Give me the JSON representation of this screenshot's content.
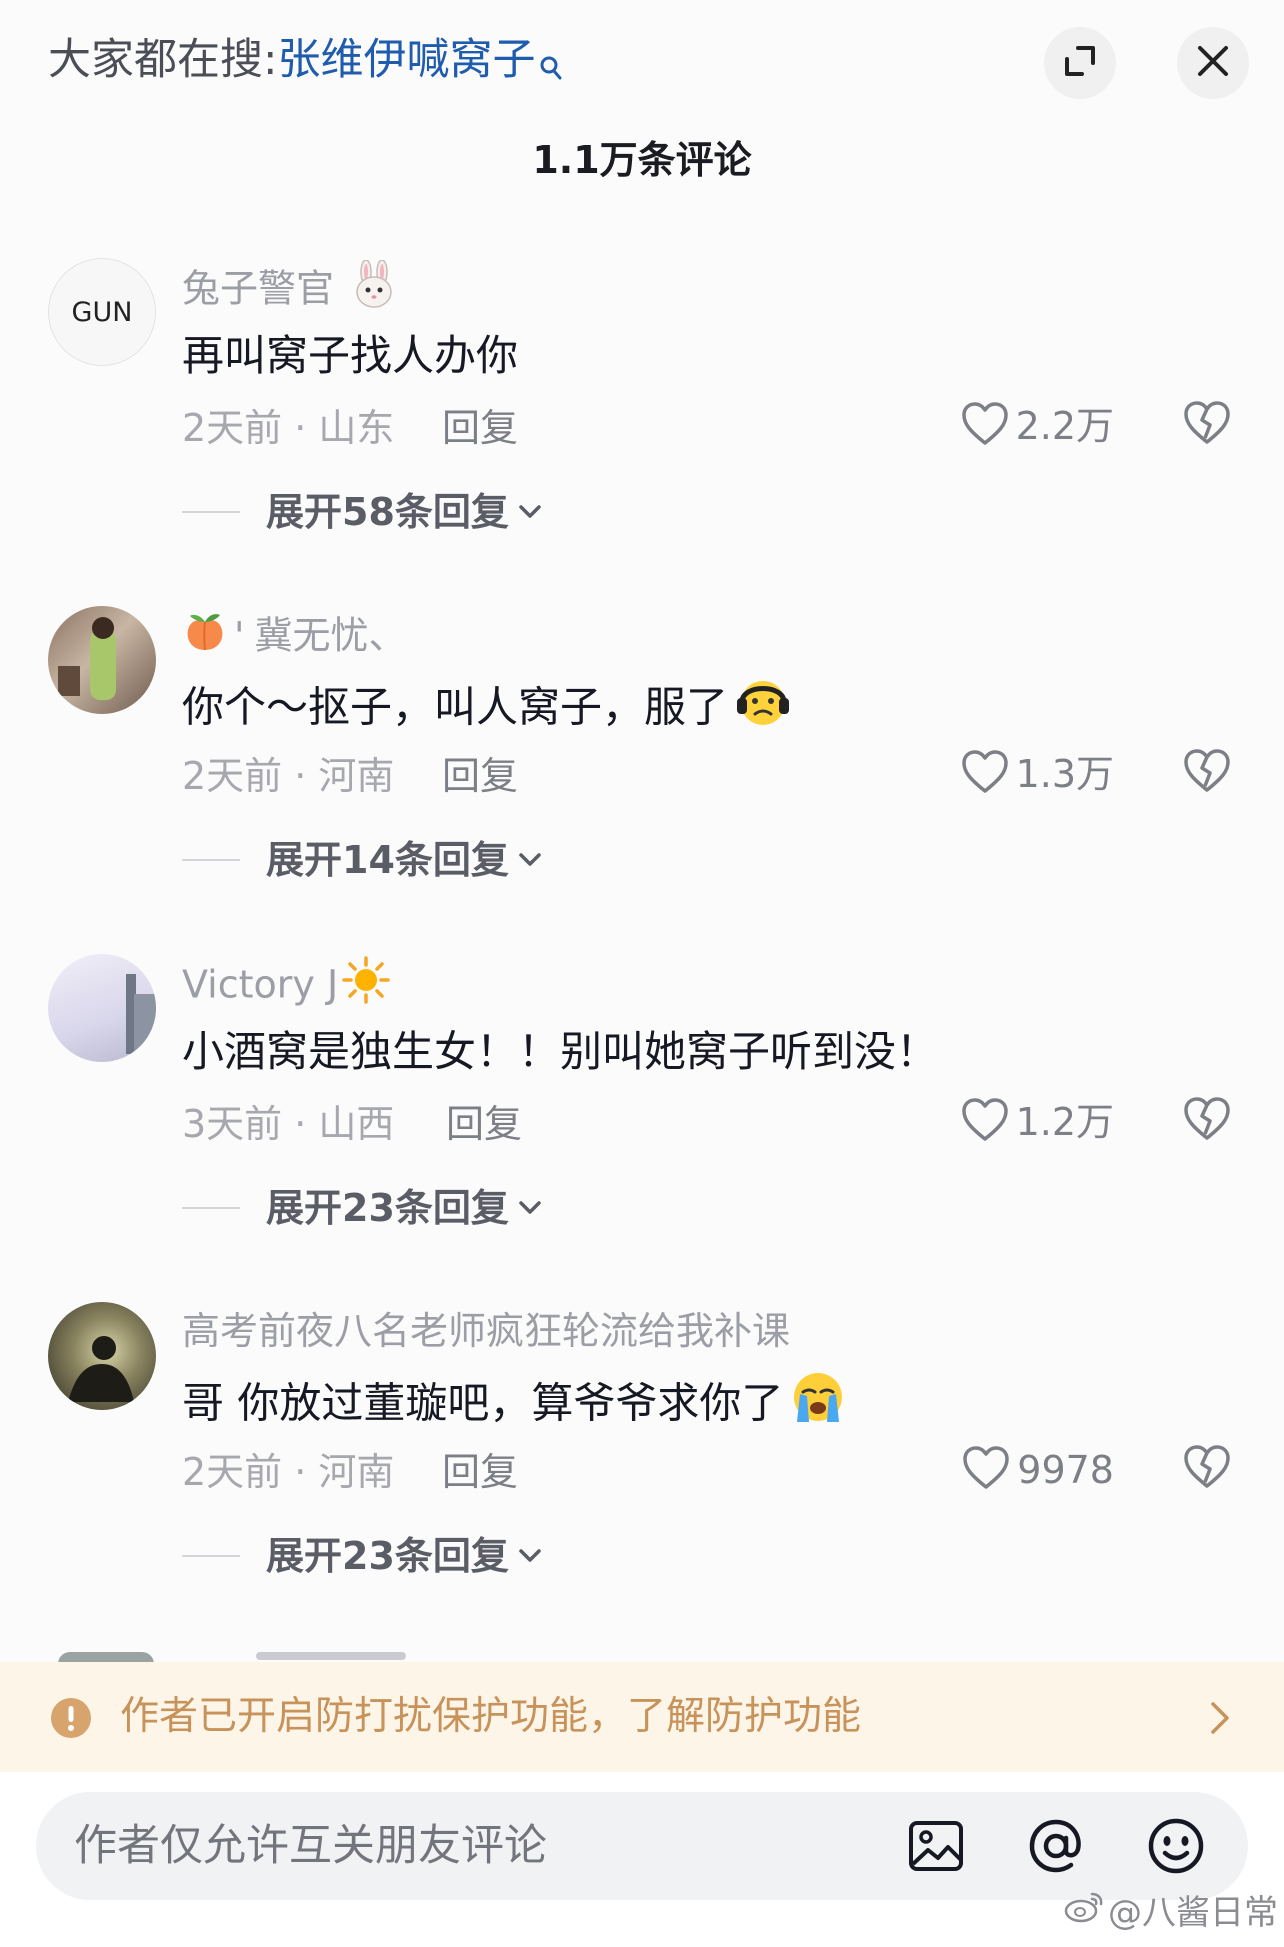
{
  "header": {
    "search_prefix": "大家都在搜:",
    "search_term": "张维伊喊窝子",
    "comment_count": "1.1万条评论"
  },
  "comments": [
    {
      "avatar_label": "GUN",
      "username": "兔子警官",
      "username_emoji": "rabbit",
      "text": "再叫窝子找人办你",
      "text_emoji": "",
      "meta": "2天前 · 山东",
      "reply": "回复",
      "likes": "2.2万",
      "expand": "展开58条回复"
    },
    {
      "avatar_label": "",
      "username": "冀无忧、",
      "username_prefix": "'",
      "username_emoji": "peach",
      "text": "你个～抠子，叫人窝子，服了",
      "text_emoji": "headphone-face",
      "meta": "2天前 · 河南",
      "reply": "回复",
      "likes": "1.3万",
      "expand": "展开14条回复"
    },
    {
      "avatar_label": "",
      "username": "Victory J",
      "username_emoji": "sun",
      "text": "小酒窝是独生女！！别叫她窝子听到没！",
      "text_emoji": "",
      "meta": "3天前 · 山西",
      "reply": "回复",
      "likes": "1.2万",
      "expand": "展开23条回复"
    },
    {
      "avatar_label": "",
      "username": "高考前夜八名老师疯狂轮流给我补课",
      "username_emoji": "",
      "text": "哥 你放过董璇吧，算爷爷求你了",
      "text_emoji": "crying-face",
      "meta": "2天前 · 河南",
      "reply": "回复",
      "likes": "9978",
      "expand": "展开23条回复"
    }
  ],
  "banner": {
    "text": "作者已开启防打扰保护功能，了解防护功能"
  },
  "input": {
    "placeholder": "作者仅允许互关朋友评论"
  },
  "watermark": "@八酱日常",
  "colors": {
    "search_term": "#1f5cae",
    "banner_bg": "#fdf5e8",
    "banner_text": "#c7935a"
  }
}
